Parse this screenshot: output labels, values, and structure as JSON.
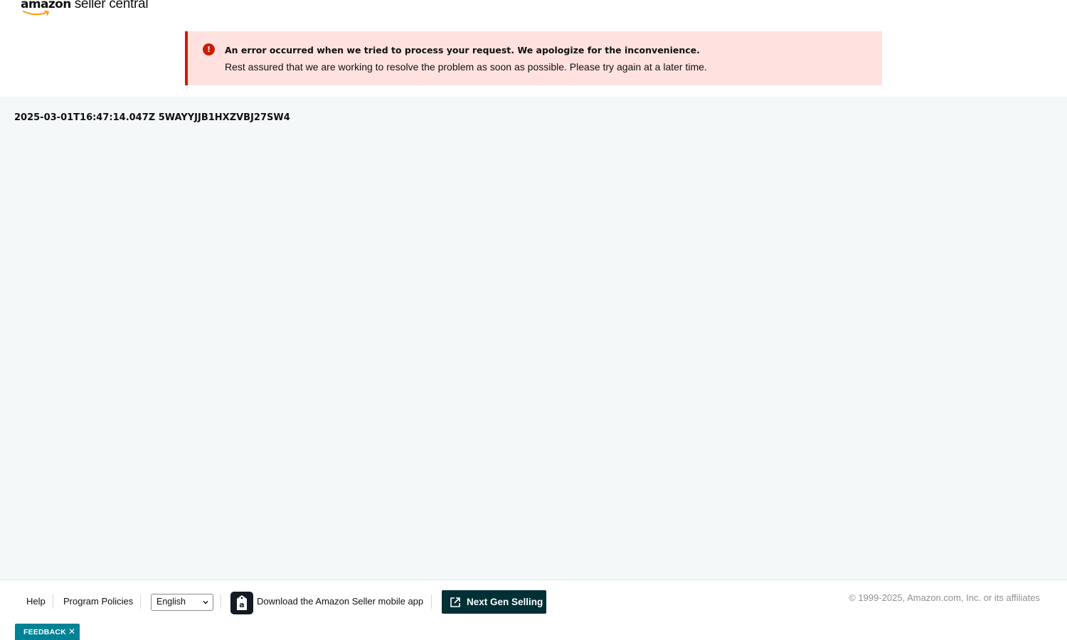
{
  "header": {
    "logo_amazon": "amazon",
    "logo_product": "seller central"
  },
  "alert": {
    "icon": "exclamation-circle-icon",
    "icon_glyph": "!",
    "title": "An error occurred when we tried to process your request. We apologize for the inconvenience.",
    "body": "Rest assured that we are working to resolve the problem as soon as possible. Please try again at a later time.",
    "color": "#cc1c06"
  },
  "main": {
    "request_id": "2025-03-01T16:47:14.047Z 5WAYYJJB1HXZVBJ27SW4"
  },
  "footer": {
    "help": "Help",
    "program_policies": "Program Policies",
    "language": "English",
    "app_download": "Download the Amazon Seller mobile app",
    "next_gen_selling": "Next Gen Selling",
    "copyright": "© 1999-2025, Amazon.com, Inc. or its affiliates"
  },
  "feedback": {
    "label": "FEEDBACK",
    "close": "✕"
  },
  "colors": {
    "brand_smile": "#ff9900",
    "main_background": "#f5f8f8",
    "next_gen_button": "#002f36",
    "feedback_tab": "#008296"
  }
}
